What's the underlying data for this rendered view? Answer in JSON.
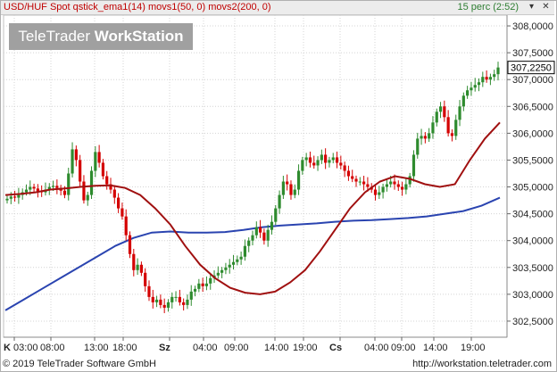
{
  "header": {
    "title": "USD/HUF Spot qstick_ema1(14) movs1(50, 0) movs2(200, 0)",
    "status": "15 perc (2:52)",
    "minimize_symbol": "▾",
    "close_symbol": "✕"
  },
  "watermark": {
    "part1": "TeleTrader ",
    "part2": "WorkStation"
  },
  "footer": {
    "copyright": "© 2019 TeleTrader Software GmbH",
    "url": "http://workstation.teletrader.com"
  },
  "colors": {
    "up": "#2e8b2e",
    "down": "#d40000",
    "movs1": "#a01010",
    "movs2": "#2a44b0",
    "last_label_bg": "#ffffff"
  },
  "chart_data": {
    "type": "candlestick",
    "instrument": "USD/HUF Spot",
    "ylim": [
      302.2,
      308.2
    ],
    "y_ticks": [
      302.5,
      303.0,
      303.5,
      304.0,
      304.5,
      305.0,
      305.5,
      306.0,
      306.5,
      307.0,
      307.5,
      308.0
    ],
    "y_tick_labels": [
      "302,5000",
      "303,0000",
      "303,5000",
      "304,0000",
      "304,5000",
      "305,0000",
      "305,5000",
      "306,0000",
      "306,5000",
      "307,0000",
      "307,5000",
      "308,0000"
    ],
    "x_tick_labels": [
      "K 03:00",
      "08:00",
      "13:00",
      "18:00",
      "Sz",
      "04:00",
      "09:00",
      "14:00",
      "19:00",
      "Cs",
      "04:00",
      "09:00",
      "14:00",
      "19:00"
    ],
    "last_value": 307.225,
    "last_value_label": "307,2250",
    "grid": true,
    "series": [
      {
        "name": "movs1(50, 0)",
        "values": [
          304.85,
          304.87,
          304.9,
          304.95,
          304.97,
          305.0,
          305.02,
          305.03,
          304.98,
          304.85,
          304.6,
          304.3,
          303.9,
          303.55,
          303.3,
          303.12,
          303.03,
          303.0,
          303.05,
          303.22,
          303.45,
          303.8,
          304.2,
          304.6,
          304.9,
          305.1,
          305.2,
          305.15,
          305.05,
          305.0,
          305.05,
          305.5,
          305.9,
          306.2
        ]
      },
      {
        "name": "movs2(200, 0)",
        "values": [
          302.7,
          302.9,
          303.1,
          303.3,
          303.5,
          303.7,
          303.9,
          304.05,
          304.15,
          304.17,
          304.15,
          304.15,
          304.16,
          304.2,
          304.25,
          304.28,
          304.3,
          304.32,
          304.35,
          304.37,
          304.38,
          304.4,
          304.42,
          304.45,
          304.5,
          304.55,
          304.65,
          304.8
        ]
      }
    ],
    "candles_close": [
      304.78,
      304.82,
      304.8,
      304.85,
      304.9,
      304.95,
      305.0,
      304.97,
      304.92,
      304.9,
      304.95,
      305.0,
      305.02,
      304.98,
      304.93,
      304.85,
      305.25,
      305.7,
      305.5,
      305.1,
      304.75,
      304.85,
      305.3,
      305.65,
      305.45,
      305.2,
      305.05,
      304.95,
      304.8,
      304.6,
      304.45,
      304.1,
      303.75,
      303.45,
      303.55,
      303.4,
      303.15,
      302.95,
      302.85,
      302.9,
      302.8,
      302.75,
      302.85,
      302.95,
      302.95,
      302.85,
      302.8,
      302.9,
      303.05,
      303.1,
      303.2,
      303.15,
      303.2,
      303.3,
      303.35,
      303.4,
      303.45,
      303.5,
      303.55,
      303.6,
      303.65,
      303.7,
      303.9,
      304.0,
      304.1,
      304.25,
      304.15,
      304.0,
      304.2,
      304.35,
      304.6,
      304.85,
      305.1,
      305.05,
      304.85,
      304.95,
      305.3,
      305.5,
      305.55,
      305.45,
      305.4,
      305.5,
      305.6,
      305.45,
      305.5,
      305.55,
      305.45,
      305.4,
      305.3,
      305.2,
      305.15,
      305.1,
      305.1,
      305.05,
      305.0,
      304.95,
      304.85,
      304.9,
      305.0,
      305.05,
      305.1,
      305.05,
      305.0,
      304.95,
      305.05,
      305.2,
      305.6,
      305.9,
      305.95,
      305.9,
      306.0,
      306.2,
      306.4,
      306.5,
      306.3,
      306.0,
      305.95,
      306.25,
      306.5,
      306.7,
      306.8,
      306.85,
      306.9,
      306.95,
      307.05,
      307.0,
      307.05,
      307.1,
      307.225
    ]
  }
}
